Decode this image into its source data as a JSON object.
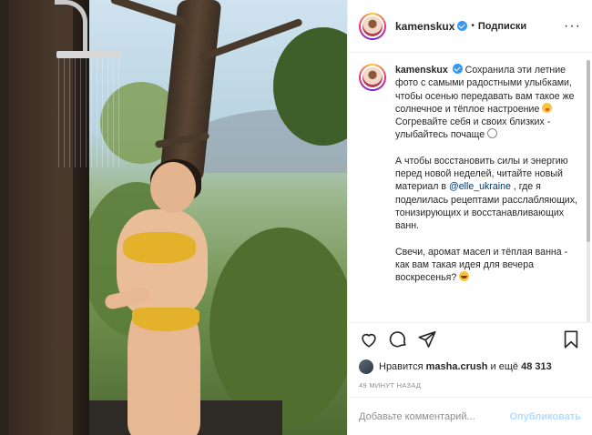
{
  "post": {
    "username": "kamenskux",
    "follow_separator": "•",
    "follow_label": "Подписки",
    "more_label": "···"
  },
  "caption": {
    "username": "kamenskux",
    "para1_a": "Сохранила эти летние фото с самыми радостными улыбками, чтобы осенью передавать вам такое же солнечное и тёплое настроение ",
    "para1_b": " Согревайте себя и своих близких - улыбайтесь почаще ",
    "para2_a": "А чтобы восстановить силы и энергию перед новой неделей, читайте новый материал в ",
    "mention": "@elle_ukraine",
    "para2_b": " , где я поделилась рецептами расслабляющих, тонизирующих и восстанавливающих ванн.",
    "para3_a": "Свечи, аромат масел и тёплая ванна - как вам такая идея для вечера воскресенья? "
  },
  "likes": {
    "prefix": "Нравится",
    "user": "masha.crush",
    "middle": "и ещё",
    "count": "48 313"
  },
  "time_ago": "49 МИНУТ НАЗАД",
  "comment": {
    "placeholder": "Добавьте комментарий...",
    "post_label": "Опубликовать"
  },
  "icons": [
    "verified-icon",
    "more-icon",
    "heart-icon",
    "comment-icon",
    "share-icon",
    "bookmark-icon"
  ],
  "colors": {
    "link": "#00376b",
    "verified": "#3897f0",
    "post_disabled": "#b3dbff"
  }
}
